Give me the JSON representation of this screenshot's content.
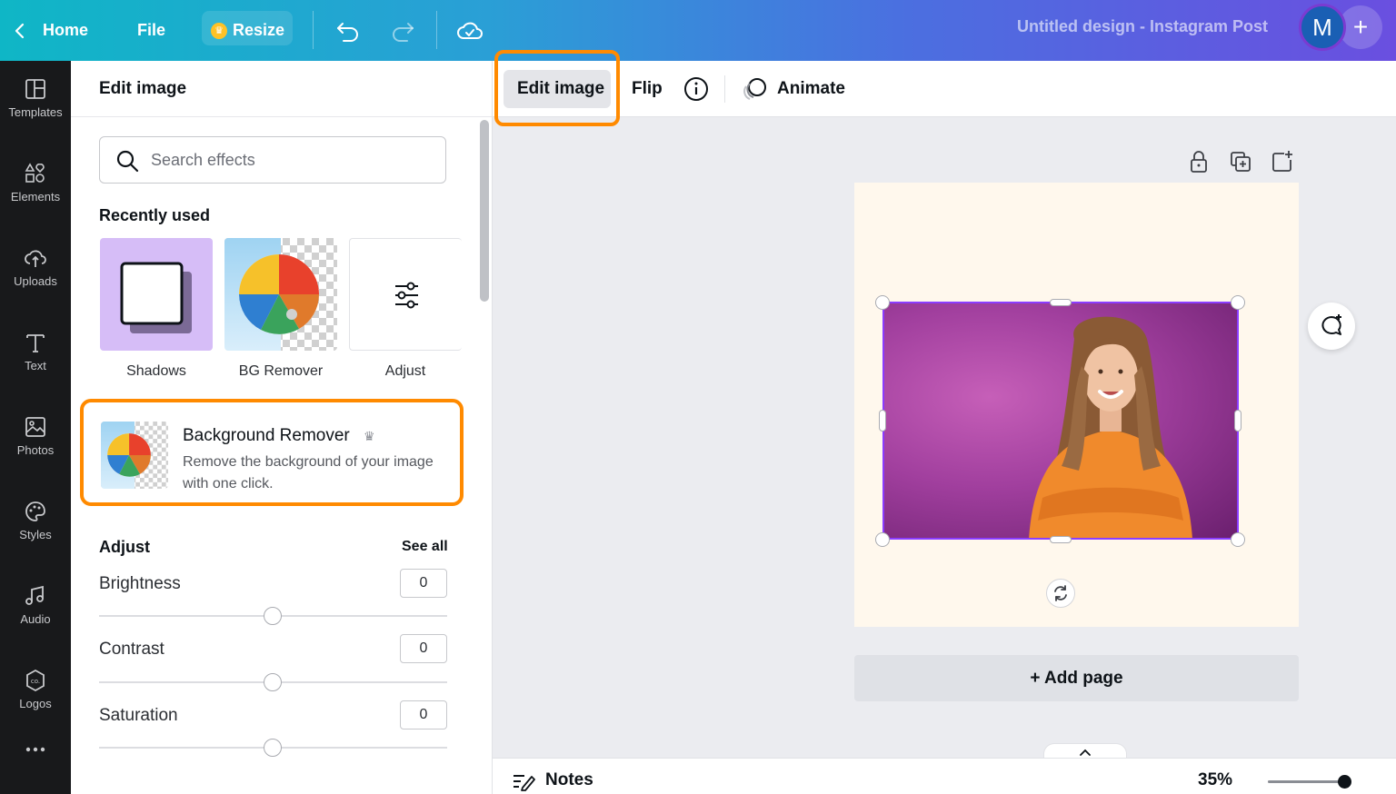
{
  "topbar": {
    "home": "Home",
    "file": "File",
    "resize": "Resize",
    "doc_title": "Untitled design - Instagram Post",
    "avatar_initial": "M",
    "plus": "+"
  },
  "leftnav": [
    {
      "label": "Templates",
      "icon": "templates-icon"
    },
    {
      "label": "Elements",
      "icon": "elements-icon"
    },
    {
      "label": "Uploads",
      "icon": "uploads-icon"
    },
    {
      "label": "Text",
      "icon": "text-icon"
    },
    {
      "label": "Photos",
      "icon": "photos-icon"
    },
    {
      "label": "Styles",
      "icon": "styles-icon"
    },
    {
      "label": "Audio",
      "icon": "audio-icon"
    },
    {
      "label": "Logos",
      "icon": "logos-icon"
    }
  ],
  "panel": {
    "title": "Edit image",
    "search_placeholder": "Search effects",
    "recent_title": "Recently used",
    "recent": [
      {
        "label": "Shadows"
      },
      {
        "label": "BG Remover"
      },
      {
        "label": "Adjust"
      }
    ],
    "bg_remover": {
      "title": "Background Remover",
      "desc": "Remove the background of your image with one click."
    },
    "adjust": {
      "title": "Adjust",
      "see_all": "See all",
      "controls": [
        {
          "label": "Brightness",
          "value": "0"
        },
        {
          "label": "Contrast",
          "value": "0"
        },
        {
          "label": "Saturation",
          "value": "0"
        }
      ]
    }
  },
  "toolbar": {
    "edit_image": "Edit image",
    "flip": "Flip",
    "animate": "Animate"
  },
  "canvas": {
    "add_page": "+ Add page"
  },
  "bottombar": {
    "notes": "Notes",
    "zoom": "35%",
    "zoom_level": 0.35
  },
  "colors": {
    "accent": "#8b3dff",
    "highlight": "#ff8a00",
    "crown": "#ffc226"
  }
}
